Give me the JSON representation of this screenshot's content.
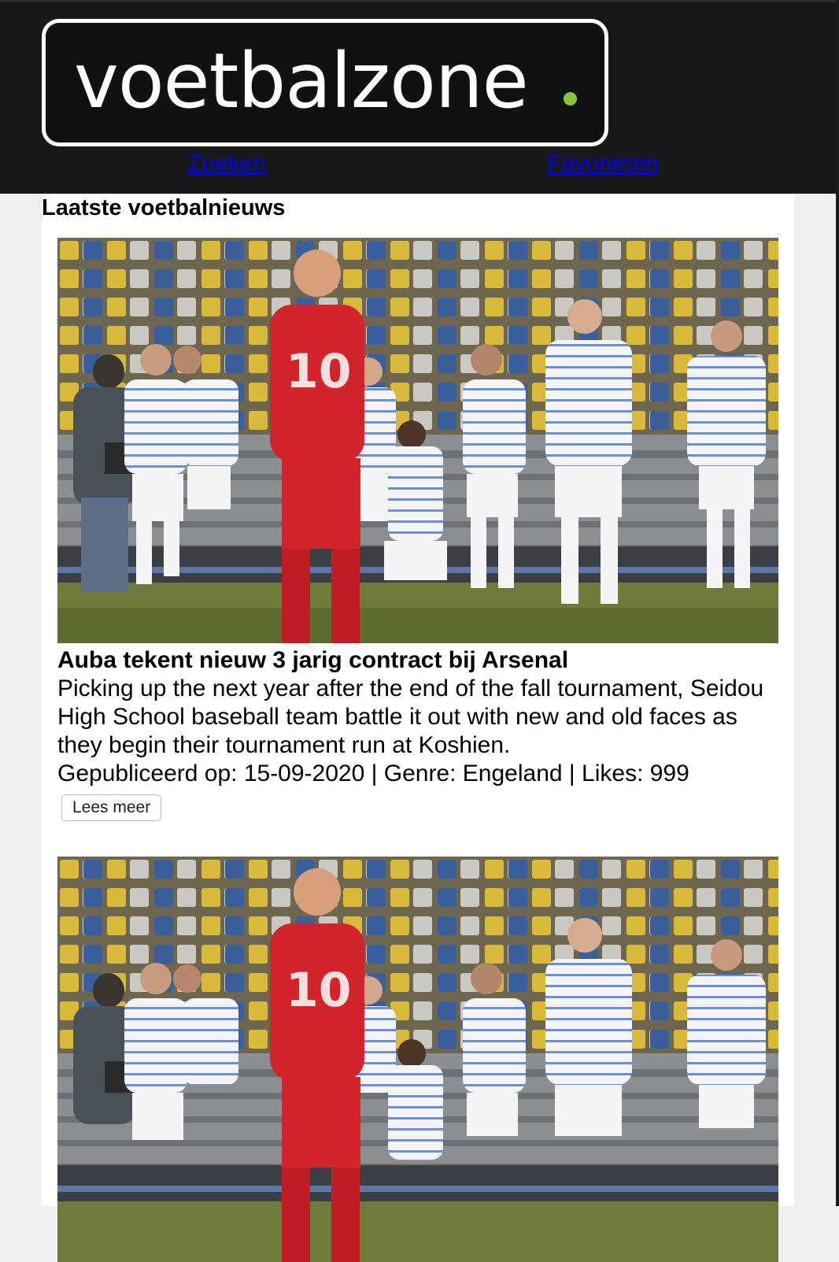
{
  "brand": {
    "name": "voetbalzone",
    "dot": ".",
    "dot_color": "#8ac43f"
  },
  "nav": {
    "search_label": "Zoeken",
    "favorites_label": "Favorieten"
  },
  "section": {
    "title": "Laatste voetbalnieuws"
  },
  "colors": {
    "link": "#0000ee",
    "header_bg": "#181818"
  },
  "articles": [
    {
      "image": "football-celebration-photo",
      "title": "Auba tekent nieuw 3 jarig contract bij Arsenal",
      "description": "Picking up the next year after the end of the fall tournament, Seidou High School baseball team battle it out with new and old faces as they begin their tournament run at Koshien.",
      "meta": "Gepubliceerd op: 15-09-2020 | Genre: Engeland | Likes: 999",
      "button_label": "Lees meer"
    },
    {
      "image": "football-celebration-photo"
    }
  ]
}
